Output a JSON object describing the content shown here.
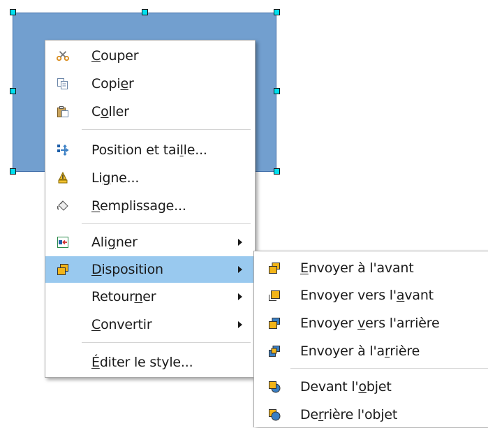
{
  "context_menu": {
    "items": [
      {
        "pre": "",
        "ul": "C",
        "post": "ouper",
        "icon": "scissors-icon"
      },
      {
        "pre": "Copi",
        "ul": "e",
        "post": "r",
        "icon": "copy-icon"
      },
      {
        "pre": "C",
        "ul": "o",
        "post": "ller",
        "icon": "paste-icon"
      },
      {
        "pre": "Position et tai",
        "ul": "l",
        "post": "le...",
        "icon": "position-size-icon"
      },
      {
        "pre": "Li",
        "ul": "g",
        "post": "ne...",
        "icon": "line-icon"
      },
      {
        "pre": "",
        "ul": "R",
        "post": "emplissage...",
        "icon": "fill-icon"
      },
      {
        "pre": "Ali",
        "ul": "g",
        "post": "ner",
        "icon": "align-icon"
      },
      {
        "pre": "",
        "ul": "D",
        "post": "isposition",
        "icon": "arrange-icon"
      },
      {
        "pre": "Retour",
        "ul": "n",
        "post": "er",
        "icon": ""
      },
      {
        "pre": "",
        "ul": "C",
        "post": "onvertir",
        "icon": ""
      },
      {
        "pre": "",
        "ul": "É",
        "post": "diter le style...",
        "icon": ""
      }
    ]
  },
  "submenu": {
    "items": [
      {
        "pre": "",
        "ul": "E",
        "post": "nvoyer à l'avant",
        "icon": "bring-to-front-icon"
      },
      {
        "pre": "Envoyer vers l'",
        "ul": "a",
        "post": "vant",
        "icon": "bring-forward-icon"
      },
      {
        "pre": "Envoyer ",
        "ul": "v",
        "post": "ers l'arrière",
        "icon": "send-backward-icon"
      },
      {
        "pre": "Envoyer à l'a",
        "ul": "r",
        "post": "rière",
        "icon": "send-to-back-icon"
      },
      {
        "pre": "Devant l'",
        "ul": "o",
        "post": "bjet",
        "icon": "in-front-of-object-icon"
      },
      {
        "pre": "De",
        "ul": "r",
        "post": "rière l'objet",
        "icon": "behind-object-icon"
      }
    ]
  },
  "colors": {
    "shape_fill": "#729fcf",
    "highlight": "#99c9ef",
    "handle": "#00e0f0"
  }
}
